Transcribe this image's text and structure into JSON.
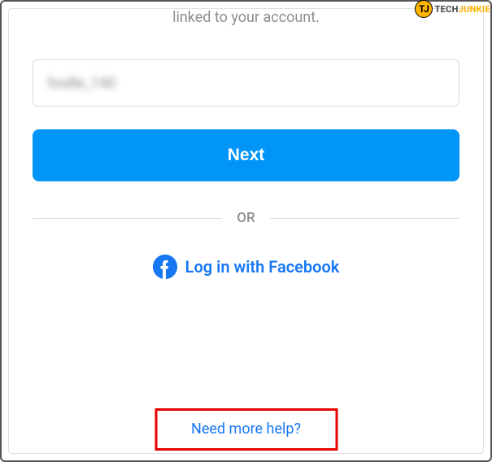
{
  "instruction": "linked to your account.",
  "input": {
    "value": "hodle_140"
  },
  "buttons": {
    "next": "Next"
  },
  "divider": "OR",
  "facebook": {
    "label": "Log in with Facebook"
  },
  "help": {
    "label": "Need more help?"
  },
  "watermark": {
    "icon": "TJ",
    "text1": "TECH",
    "text2": "JUNKIE"
  }
}
